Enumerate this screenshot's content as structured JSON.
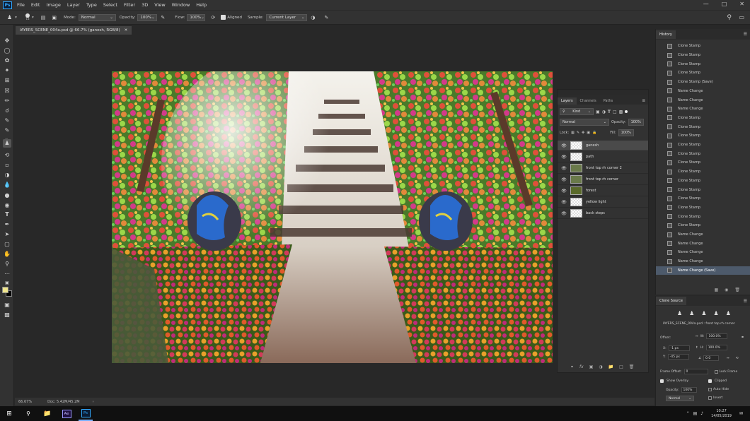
{
  "app": {
    "logo": "Ps"
  },
  "menu": [
    "File",
    "Edit",
    "Image",
    "Layer",
    "Type",
    "Select",
    "Filter",
    "3D",
    "View",
    "Window",
    "Help"
  ],
  "options": {
    "brush_size": "72",
    "mode_label": "Mode:",
    "mode_value": "Normal",
    "opacity_label": "Opacity:",
    "opacity_value": "100%",
    "flow_label": "Flow:",
    "flow_value": "100%",
    "aligned_label": "Aligned",
    "sample_label": "Sample:",
    "sample_value": "Current Layer"
  },
  "document": {
    "tab_title": "lAYERS_SCENE_004a.psd @ 66.7% (ganesh, RGB/8)",
    "zoom": "66.67%",
    "doc_info": "Doc: 5.42M/45.2M"
  },
  "layers_panel": {
    "tabs": [
      "Layers",
      "Channels",
      "Paths"
    ],
    "kind_label": "Kind",
    "blend_mode": "Normal",
    "opacity_label": "Opacity:",
    "opacity_value": "100%",
    "lock_label": "Lock:",
    "fill_label": "Fill:",
    "fill_value": "100%",
    "layers": [
      {
        "name": "ganesh"
      },
      {
        "name": "path"
      },
      {
        "name": "front top rh corner 2"
      },
      {
        "name": "front top rh corner"
      },
      {
        "name": "forest"
      },
      {
        "name": "yellow light"
      },
      {
        "name": "back steps"
      }
    ],
    "footer_icons": [
      "link-icon",
      "fx-icon",
      "mask-icon",
      "adjustment-icon",
      "group-icon",
      "new-layer-icon",
      "trash-icon"
    ]
  },
  "history": {
    "title": "History",
    "items": [
      "Clone Stamp",
      "Clone Stamp",
      "Clone Stamp",
      "Clone Stamp",
      "Clone Stamp (Save)",
      "Name Change",
      "Name Change",
      "Name Change",
      "Clone Stamp",
      "Clone Stamp",
      "Clone Stamp",
      "Clone Stamp",
      "Clone Stamp",
      "Clone Stamp",
      "Clone Stamp",
      "Clone Stamp",
      "Clone Stamp",
      "Clone Stamp",
      "Clone Stamp",
      "Clone Stamp",
      "Clone Stamp",
      "Name Change",
      "Name Change",
      "Name Change",
      "Name Change",
      "Name Change (Save)"
    ]
  },
  "clone_source": {
    "title": "Clone Source",
    "source_file": "lAYERS_SCENE_004a.psd : front top rh corner",
    "offset_label": "Offset:",
    "x_label": "X:",
    "x_value": "-1 px",
    "y_label": "Y:",
    "y_value": "-45 px",
    "w_label": "W:",
    "w_value": "100.0%",
    "h_label": "H:",
    "h_value": "100.0%",
    "angle_value": "0.0",
    "frame_offset_label": "Frame Offset:",
    "frame_offset_value": "0",
    "lock_frame_label": "Lock Frame",
    "show_overlay_label": "Show Overlay",
    "clipped_label": "Clipped",
    "opacity_label": "Opacity:",
    "opacity_value": "100%",
    "auto_hide_label": "Auto Hide",
    "mode_value": "Normal",
    "invert_label": "Invert"
  },
  "taskbar": {
    "apps": [
      "Ae",
      "Ps"
    ],
    "time": "10:27",
    "date": "14/05/2019"
  },
  "colors": {
    "foreground": "#f0e68c",
    "background": "#000000",
    "accent": "#31a8ff"
  }
}
